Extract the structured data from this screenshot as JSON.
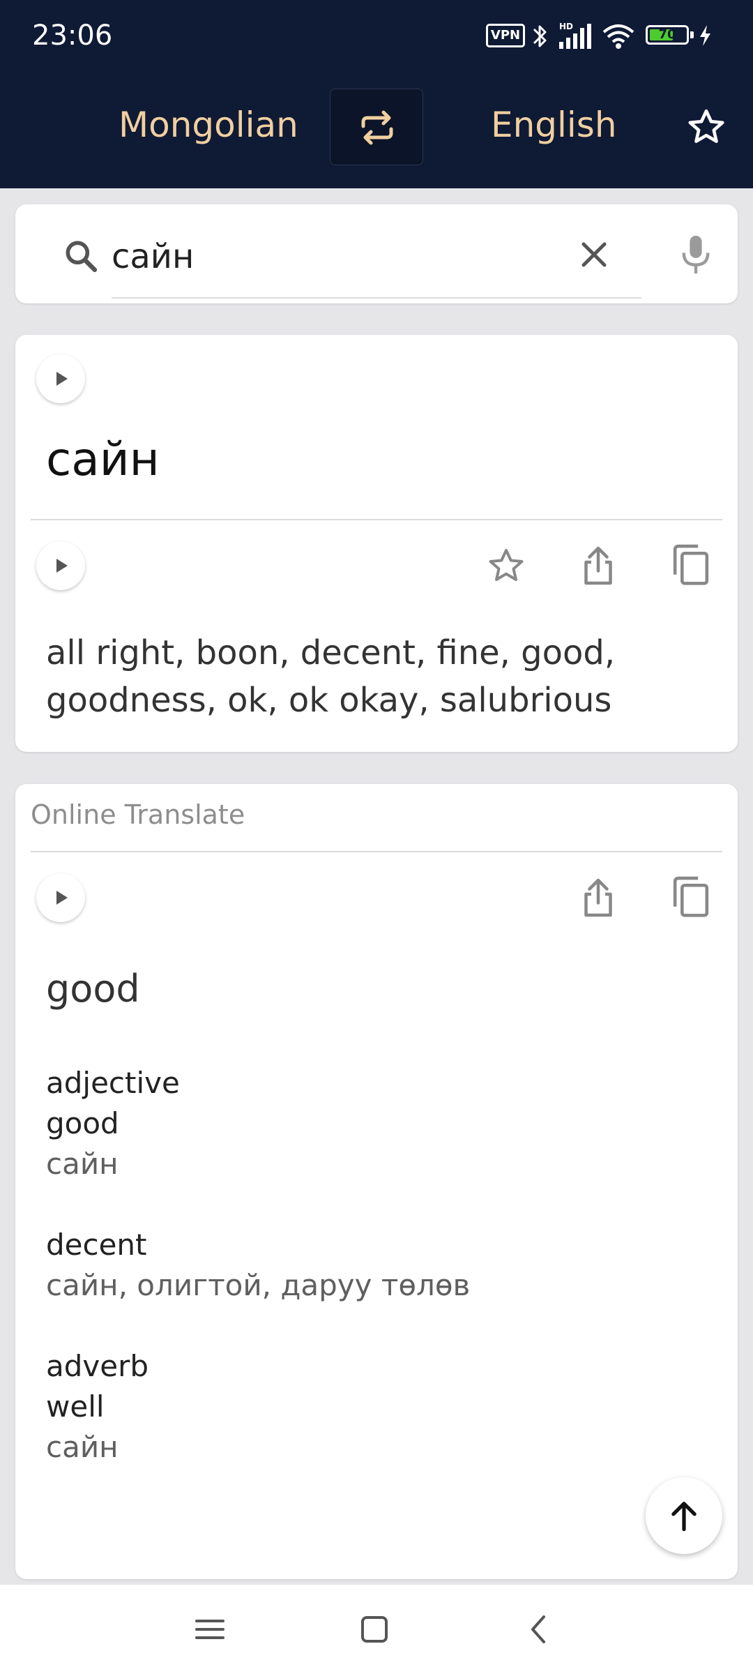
{
  "status_bar": {
    "time": "23:06",
    "vpn": "VPN",
    "battery_level": "70",
    "battery_percent": 70,
    "icons": [
      "vpn-icon",
      "bluetooth-icon",
      "hd-signal-icon",
      "wifi-icon",
      "battery-icon",
      "charging-icon"
    ]
  },
  "header": {
    "source_language": "Mongolian",
    "target_language": "English",
    "swap_icon": "swap-icon",
    "favorite_icon": "star-icon",
    "colors": {
      "background": "#0f1a35",
      "language_text": "#f0cfa0"
    }
  },
  "search": {
    "query": "сайн",
    "icons": [
      "search-icon",
      "close-icon",
      "mic-icon"
    ]
  },
  "dictionary": {
    "headword": "сайн",
    "translations": "all right, boon, decent, fine, good, goodness, ok, ok okay, salubrious",
    "actions": [
      "play-icon",
      "star-icon",
      "share-icon",
      "copy-icon"
    ]
  },
  "online_translate": {
    "label": "Online Translate",
    "main_translation": "good",
    "entries": [
      {
        "pos": "adjective",
        "word": "good",
        "reverse": "сайн"
      },
      {
        "pos": "",
        "word": "decent",
        "reverse": "сайн, олигтой, даруу төлөв"
      },
      {
        "pos": "adverb",
        "word": "well",
        "reverse": "сайн"
      }
    ],
    "actions": [
      "play-icon",
      "share-icon",
      "copy-icon"
    ]
  },
  "scroll_top_icon": "arrow-up-icon",
  "nav_bar": [
    "menu-icon",
    "home-icon",
    "back-icon"
  ]
}
